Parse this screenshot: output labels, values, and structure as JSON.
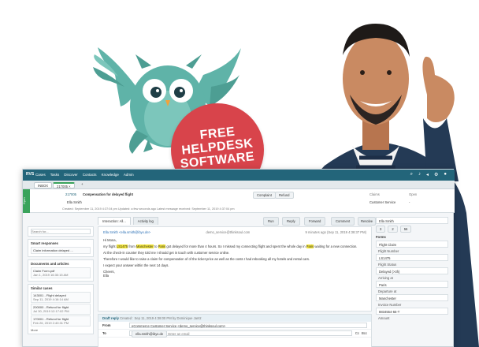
{
  "hero": {
    "badge_lines": [
      "FREE",
      "HELPDESK",
      "SOFTWARE"
    ]
  },
  "colors": {
    "teal": "#23657a",
    "badge_red": "#d8444b",
    "owl_teal": "#5fb3a8",
    "green": "#3aa35b",
    "highlight": "#f6e83a"
  },
  "topbar": {
    "logo": "RVS",
    "nav": [
      "Cases",
      "Tasks",
      "Discover",
      "Contacts",
      "Knowledge",
      "Admin"
    ],
    "icons": [
      "search-icon",
      "bell-icon",
      "megaphone-icon",
      "gear-icon",
      "avatar"
    ]
  },
  "tabs": {
    "inbox": "INBOX",
    "ticket": "217005",
    "add": "+"
  },
  "ticket": {
    "status_strip": "Open",
    "number": "217005",
    "title": "Compensation for delayed flight",
    "tags": [
      "Complaint",
      "Refund"
    ],
    "customer": "Ella Smith",
    "meta": "Created: September 11, 2019 4:37:04 pm   Updated: a few seconds ago   Latest message received: September 11, 2019 4:37:04 pm",
    "claims_label": "Claims",
    "claims_value": "Customer Service",
    "open_label": "Open",
    "open_value": "-"
  },
  "left": {
    "search_placeholder": "Search for...",
    "smart_title": "Smart responses",
    "smart_item": "Claim information delayed ...",
    "docs_title": "Documents and articles",
    "doc_name": "Claim Form.pdf",
    "doc_date": "Jan 1, 2019 16:30:15 AM",
    "similar_title": "Similar cases",
    "cases": [
      {
        "title": "143001 - Flight delayed",
        "date": "Sep 11, 2019 4:16:14 AM"
      },
      {
        "title": "200000 - Refund for flight",
        "date": "Jul 30, 2019 12:17:02 PM"
      },
      {
        "title": "170001 - Refund for flight",
        "date": "Feb 26, 2019 2:40:31 PM"
      }
    ],
    "more": "More"
  },
  "middle": {
    "tabs": [
      "Interaction: All...",
      "Activity log"
    ],
    "actions": [
      "Run",
      "Reply",
      "Forward",
      "Comment",
      "Resolve"
    ],
    "from": "Ella Smith <ella.smith@ibyx.de>",
    "to": "demo_service@thinksoul.com",
    "time": "9 minutes ago (Sep 11, 2019 4:38:37 PM)",
    "greeting": "Hi Mona,",
    "body1_pre": "my flight ",
    "flight": "LS1475",
    "body1_mid": " from ",
    "from_city": "Manchester",
    "body1_to": " to ",
    "to_city": "Paris",
    "body1_post": " got delayed for more than 4 hours. So I missed my connecting flight and spent the whole day in ",
    "city2": "Paris",
    "body1_end": " waiting for a new connection.",
    "body2": "At the check-in counter they told me I should get in touch with customer service online.",
    "body3": "Therefore I would like to raise a claim for compensation of of the ticket price as well as the costs I had rebooking all my hotels and rental cars.",
    "body4": "I expect your answer within the next 14 days.",
    "sign1": "Cheers,",
    "sign2": "Ella",
    "draft_title": "Draft reply",
    "draft_meta": "Created : Sep 11, 2019 4:38:00 PM by Dominique Jantz",
    "from_label": "From",
    "from_value": "eCommerce Customer Service <demo_service@thinksoul.com>",
    "to_label": "To",
    "to_chip": "ella.smith@ibyx.de",
    "to_placeholder": "Enter an email",
    "cc": "Cc",
    "bcc": "Bcc"
  },
  "right": {
    "contact": "Ella Smith",
    "forms_title": "Forms",
    "form_type": "Flight Claim",
    "flight_number_label": "Flight Number",
    "flight_number": "LS1475",
    "flight_status_label": "Flight Status",
    "flight_status": "Delayed (>3h)",
    "arriving_label": "Arriving at",
    "arriving": "Paris",
    "departure_label": "Departure at",
    "departure": "Manchester",
    "invoice_label": "Invoice Number",
    "invoice": "8834554-55-T",
    "amount_label": "Amount",
    "counts": [
      "3",
      "2",
      "56"
    ]
  }
}
